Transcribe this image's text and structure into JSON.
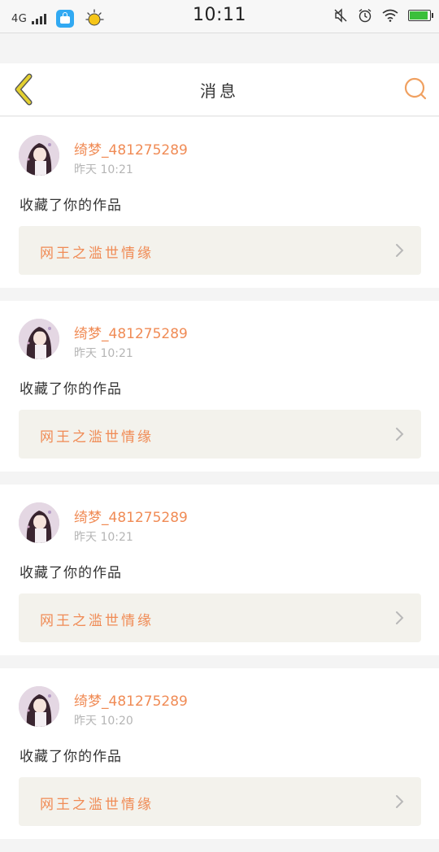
{
  "status_bar": {
    "network": "4G",
    "time": "10:11",
    "icons": [
      "signal-icon",
      "app-store-icon",
      "weather-icon",
      "mute-icon",
      "alarm-icon",
      "wifi-icon",
      "battery-icon"
    ]
  },
  "header": {
    "title": "消息",
    "back_icon": "chevron-left-icon",
    "search_icon": "search-icon"
  },
  "colors": {
    "accent": "#f08b55",
    "back_icon": "#e0cc2a",
    "work_card_bg": "#f3f2ec"
  },
  "messages": [
    {
      "user": "绮梦_481275289",
      "time": "昨天 10:21",
      "action": "收藏了你的作品",
      "work": "网王之滥世情缘"
    },
    {
      "user": "绮梦_481275289",
      "time": "昨天 10:21",
      "action": "收藏了你的作品",
      "work": "网王之滥世情缘"
    },
    {
      "user": "绮梦_481275289",
      "time": "昨天 10:21",
      "action": "收藏了你的作品",
      "work": "网王之滥世情缘"
    },
    {
      "user": "绮梦_481275289",
      "time": "昨天 10:20",
      "action": "收藏了你的作品",
      "work": "网王之滥世情缘"
    }
  ]
}
